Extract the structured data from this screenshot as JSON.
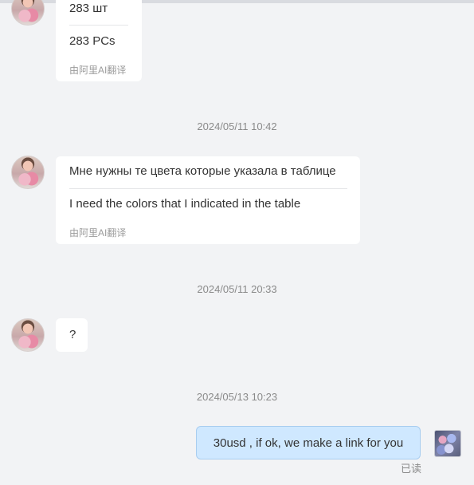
{
  "messages": [
    {
      "text": "283 шт",
      "translation": "283 PCs",
      "translation_note": "由阿里AI翻译"
    },
    {
      "timestamp": "2024/05/11 10:42",
      "text": "Мне нужны те цвета которые указала в таблице",
      "translation": "I need the colors that I indicated in the table",
      "translation_note": "由阿里AI翻译"
    },
    {
      "timestamp": "2024/05/11 20:33",
      "text": "?"
    },
    {
      "timestamp": "2024/05/13 10:23",
      "text": "30usd , if ok, we make a link for you",
      "read_status": "已读"
    }
  ],
  "colors": {
    "background": "#f2f3f5",
    "incoming_bubble": "#ffffff",
    "outgoing_bubble": "#cfe8ff",
    "outgoing_border": "#a8cdf0",
    "meta_text": "#8a8a8a"
  }
}
